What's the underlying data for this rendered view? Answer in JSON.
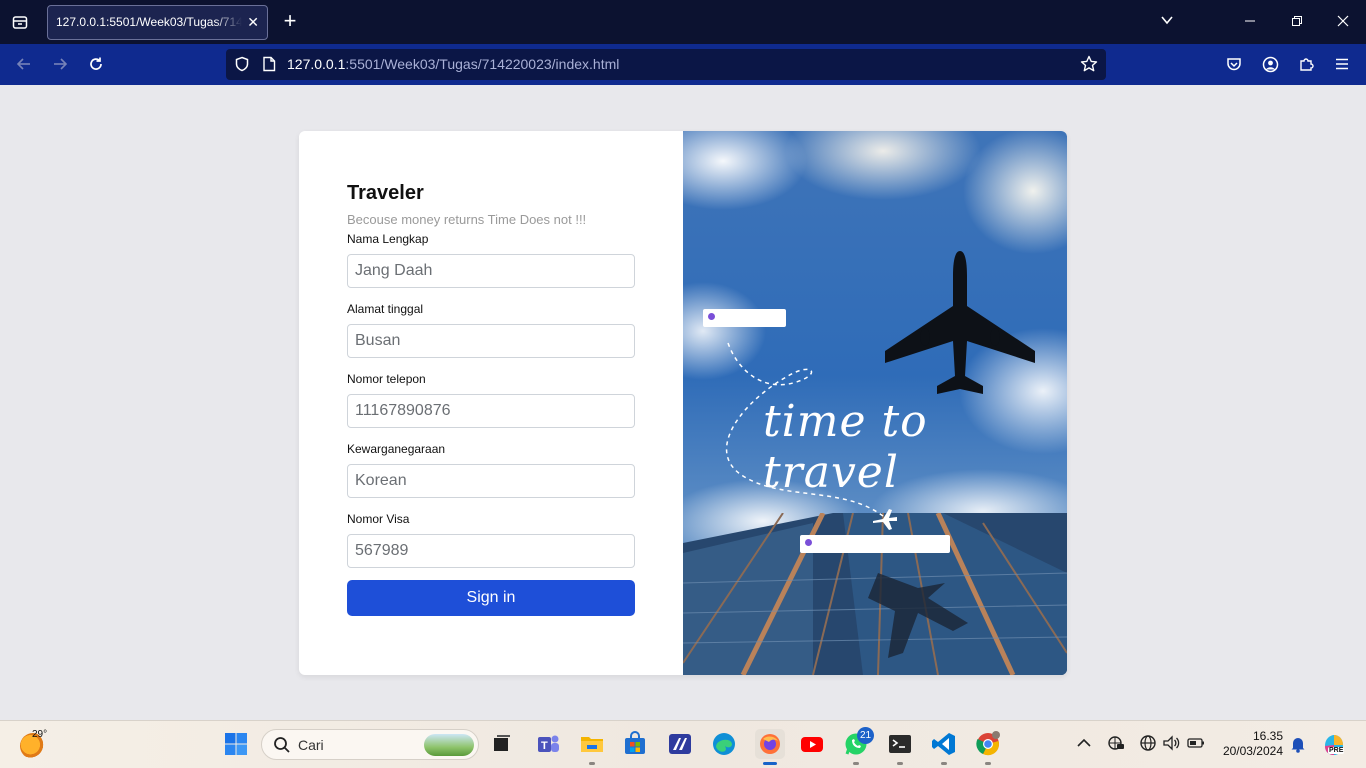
{
  "browser": {
    "tab_title": "127.0.0.1:5501/Week03/Tugas/714220023/index.html",
    "url_host": "127.0.0.1",
    "url_rest": ":5501/Week03/Tugas/714220023/index.html",
    "accent_color": "#0f2a8f"
  },
  "form": {
    "title": "Traveler",
    "subtitle": "Becouse money returns Time Does not !!!",
    "fields": [
      {
        "label": "Nama Lengkap",
        "placeholder": "Jang Daah"
      },
      {
        "label": "Alamat tinggal",
        "placeholder": "Busan"
      },
      {
        "label": "Nomor telepon",
        "placeholder": "11167890876"
      },
      {
        "label": "Kewarganegaraan",
        "placeholder": "Korean"
      },
      {
        "label": "Nomor Visa",
        "placeholder": "567989"
      }
    ],
    "submit_label": "Sign in",
    "submit_color": "#1e4fd8"
  },
  "hero": {
    "tagline": "time to travel"
  },
  "taskbar": {
    "weather_temp": "29°",
    "search_placeholder": "Cari",
    "whatsapp_badge": "21",
    "time": "16.35",
    "date": "20/03/2024",
    "copilot_badge": "PRE"
  }
}
